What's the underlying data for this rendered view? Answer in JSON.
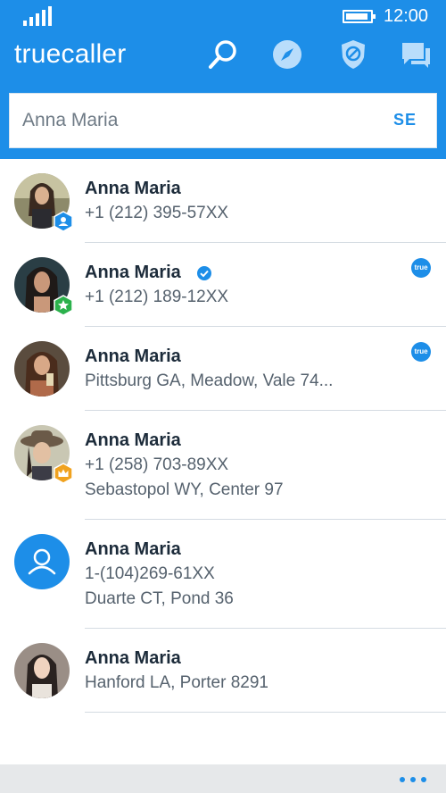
{
  "status": {
    "time": "12:00"
  },
  "app": {
    "brand": "truecaller"
  },
  "search": {
    "value": "Anna Maria",
    "button": "SE"
  },
  "colors": {
    "accent": "#1d8ee8",
    "name_text": "#1c2b3a",
    "detail_text": "#56626e"
  },
  "contacts": [
    {
      "name": "Anna Maria",
      "lines": [
        "+1 (212) 395-57XX"
      ],
      "badge": "user-badge-icon",
      "true_badge": ""
    },
    {
      "name": "Anna Maria",
      "lines": [
        "+1 (212) 189-12XX"
      ],
      "badge": "star-badge-icon",
      "verified": true,
      "true_badge": "true"
    },
    {
      "name": "Anna Maria",
      "lines": [
        "Pittsburg GA, Meadow, Vale 74..."
      ],
      "true_badge": "true"
    },
    {
      "name": "Anna Maria",
      "lines": [
        "+1 (258) 703-89XX",
        "Sebastopol WY, Center 97"
      ],
      "badge": "crown-badge-icon",
      "true_badge": ""
    },
    {
      "name": "Anna Maria",
      "lines": [
        "1-(104)269-61XX",
        "Duarte CT, Pond 36"
      ],
      "avatar": "placeholder-avatar",
      "true_badge": ""
    },
    {
      "name": "Anna Maria",
      "lines": [
        "Hanford LA, Porter 8291"
      ],
      "true_badge": ""
    }
  ]
}
